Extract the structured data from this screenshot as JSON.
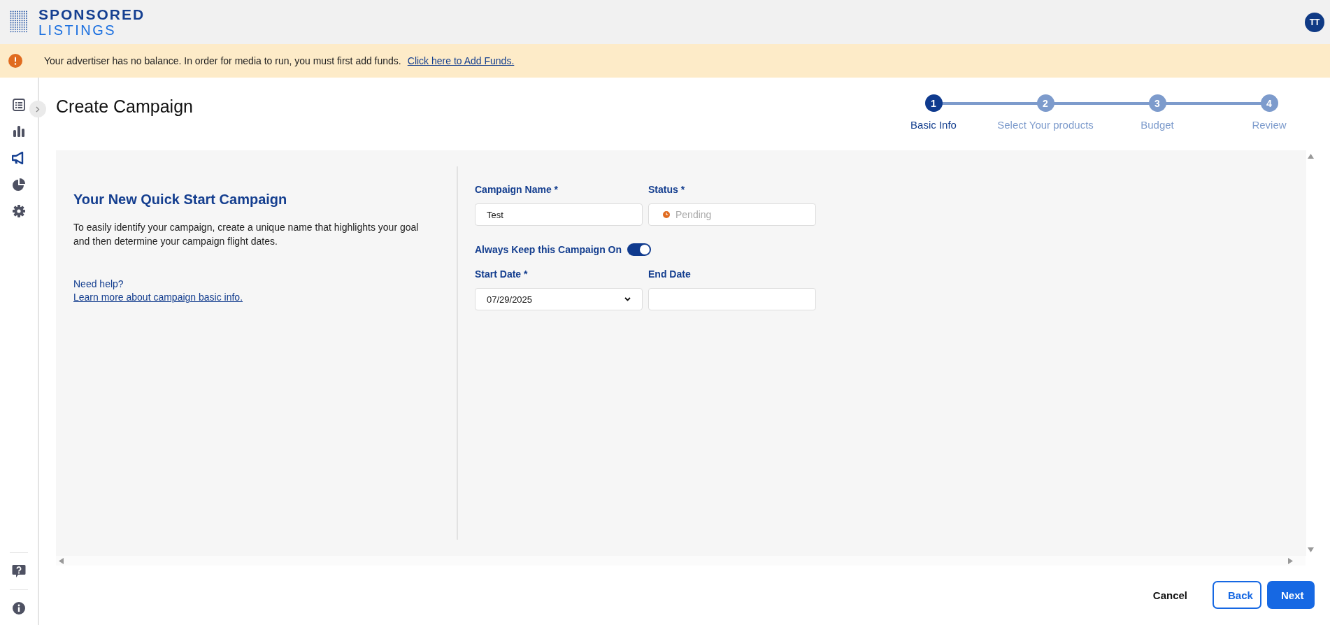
{
  "header": {
    "logo_lines": [
      "SPONSORED",
      "LISTINGS"
    ],
    "avatar": "TT"
  },
  "banner": {
    "message": "Your advertiser has no balance. In order for media to run, you must first add funds.",
    "link": "Click here to Add Funds."
  },
  "sidebar": {
    "items": [
      {
        "kind": "list",
        "selected": false
      },
      {
        "kind": "bars",
        "selected": false
      },
      {
        "kind": "megaphone",
        "selected": true
      },
      {
        "kind": "pie",
        "selected": false
      },
      {
        "kind": "gear",
        "selected": false
      }
    ],
    "bottom": [
      {
        "kind": "help"
      },
      {
        "kind": "info"
      }
    ]
  },
  "page": {
    "title": "Create Campaign"
  },
  "steps": [
    {
      "number": "1",
      "label": "Basic Info",
      "selected": true
    },
    {
      "number": "2",
      "label": "Select Your products",
      "selected": false
    },
    {
      "number": "3",
      "label": "Budget",
      "selected": false
    },
    {
      "number": "4",
      "label": "Review",
      "selected": false
    }
  ],
  "intro": {
    "heading": "Your New Quick Start Campaign",
    "text": "To easily identify your campaign, create a unique name that highlights your goal and then determine your campaign flight dates.",
    "help": "Need help?",
    "help_link": "Learn more about campaign basic info."
  },
  "form": {
    "campaign_name": {
      "label": "Campaign Name *",
      "value": "Test"
    },
    "status": {
      "label": "Status *",
      "value": "Pending",
      "disabled": true
    },
    "always_on": {
      "label": "Always Keep this Campaign On",
      "on": true
    },
    "start_date": {
      "label": "Start Date *",
      "value": "07/29/2025"
    },
    "end_date": {
      "label": "End Date"
    }
  },
  "buttons": [
    {
      "kind": "text",
      "label": "Cancel"
    },
    {
      "kind": "outline",
      "label": "Back"
    },
    {
      "kind": "primary",
      "label": "Next"
    }
  ]
}
